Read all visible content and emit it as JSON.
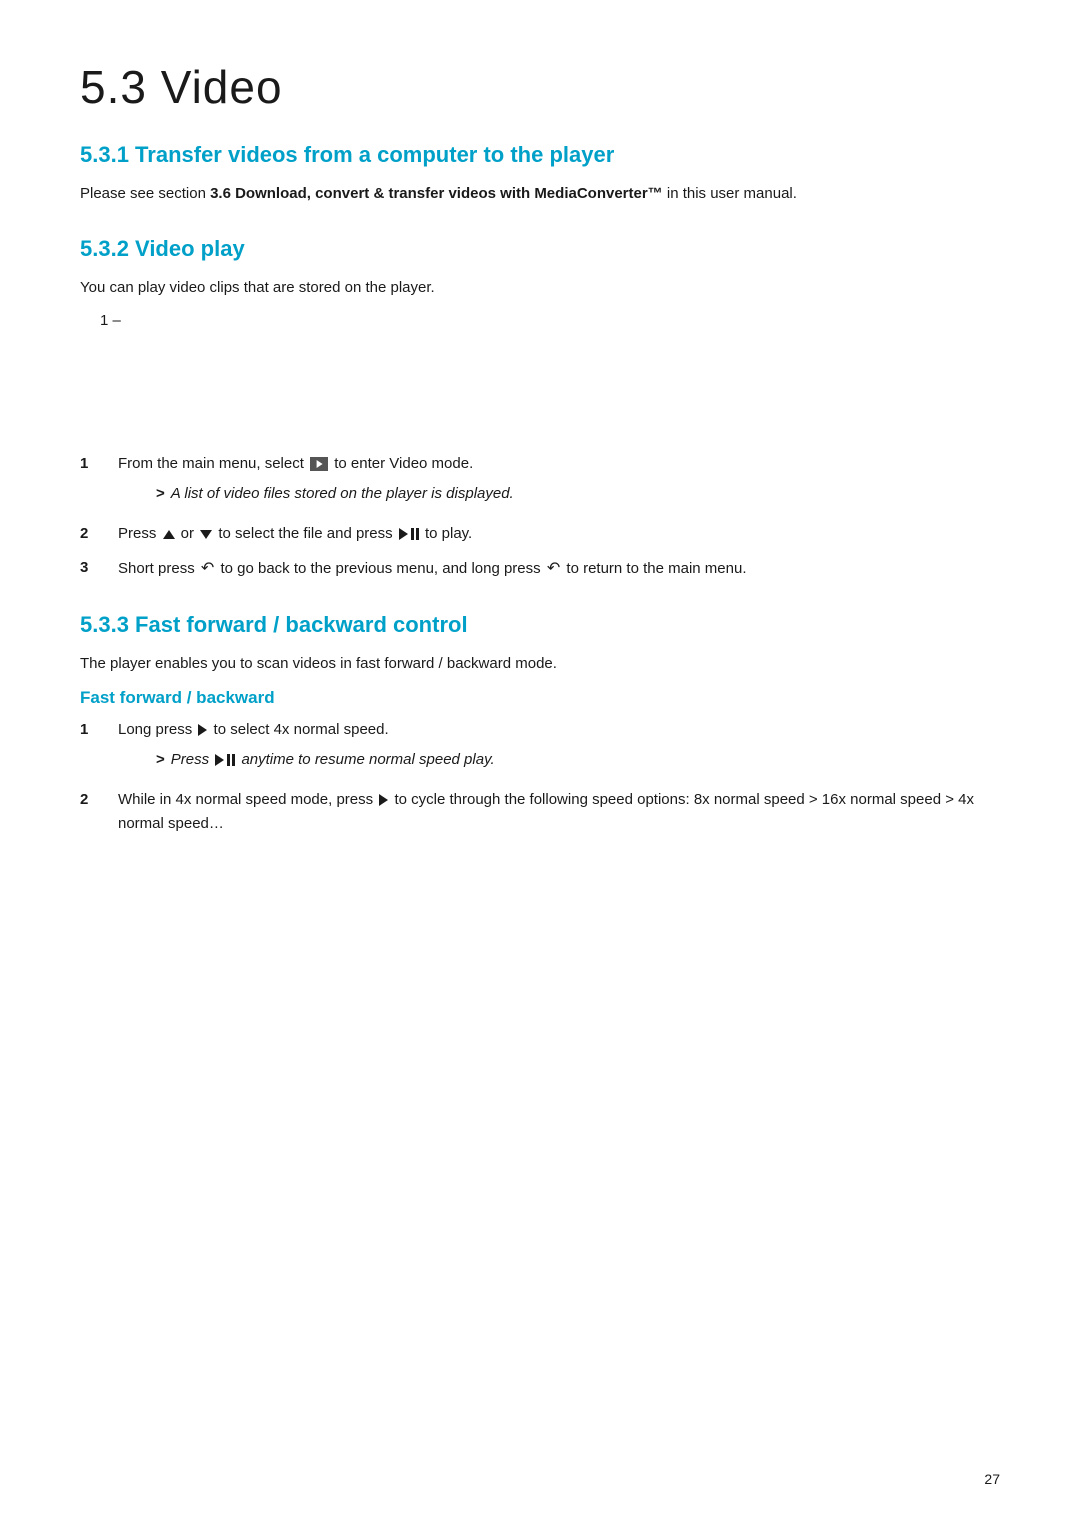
{
  "page": {
    "number": "27"
  },
  "main_title": "5.3  Video",
  "sections": {
    "s531": {
      "title": "5.3.1  Transfer videos from a computer to the player",
      "body": "Please see section ",
      "body_bold": "3.6 Download, convert & transfer videos with MediaConverter™",
      "body_end": " in this user manual."
    },
    "s532": {
      "title": "5.3.2  Video play",
      "intro": "You can play video clips that are stored on the player.",
      "diagram_label": "1 –",
      "steps": [
        {
          "number": "1",
          "text_before": "From the main menu, select ",
          "icon": "video-mode",
          "text_after": " to enter Video mode.",
          "result": "A list of video files stored on the player is displayed."
        },
        {
          "number": "2",
          "text": "Press",
          "icon1": "up",
          "text_mid": "or",
          "icon2": "down",
          "text_mid2": "to select the file and press",
          "icon3": "play-pause",
          "text_end": "to play."
        },
        {
          "number": "3",
          "text_before": "Short press",
          "icon1": "back",
          "text_mid": "to go back to the previous menu, and long press",
          "icon2": "back",
          "text_end": "to return to the main menu."
        }
      ]
    },
    "s533": {
      "title": "5.3.3  Fast forward / backward control",
      "intro": "The player enables you to scan videos in fast forward / backward mode.",
      "subsection_title": "Fast forward / backward",
      "steps": [
        {
          "number": "1",
          "text_before": "Long press",
          "icon": "play",
          "text_after": "to select 4x normal speed.",
          "result_italic_before": "Press",
          "result_icon": "play-pause",
          "result_italic_after": "anytime to resume normal speed play."
        },
        {
          "number": "2",
          "text_before": "While in 4x normal speed mode, press",
          "icon": "play",
          "text_after": "to cycle through the following speed options: 8x normal speed > 16x normal speed > 4x normal speed…"
        }
      ]
    }
  }
}
